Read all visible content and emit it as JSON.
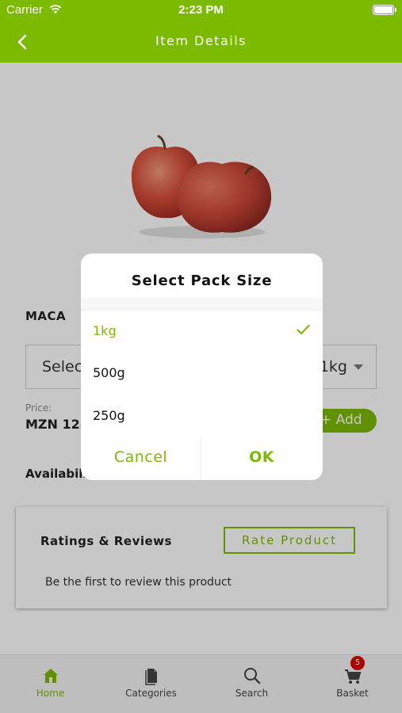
{
  "status_bar": {
    "carrier": "Carrier",
    "time": "2:23 PM"
  },
  "header": {
    "title": "Item Details"
  },
  "product": {
    "name": "MACA",
    "pack_select": {
      "placeholder": "Selec",
      "value": "1kg"
    },
    "price_label": "Price:",
    "price_value": "MZN 128",
    "add_label": "+ Add",
    "availability_label": "Availabili"
  },
  "reviews": {
    "heading": "Ratings & Reviews",
    "rate_button": "Rate Product",
    "empty_text": "Be the first to review this product"
  },
  "tab_bar": {
    "items": [
      {
        "label": "Home",
        "icon": "home-icon",
        "active": true
      },
      {
        "label": "Categories",
        "icon": "document-icon",
        "active": false
      },
      {
        "label": "Search",
        "icon": "search-icon",
        "active": false
      },
      {
        "label": "Basket",
        "icon": "cart-icon",
        "active": false,
        "badge": "5"
      }
    ]
  },
  "dialog": {
    "title": "Select Pack Size",
    "options": [
      {
        "label": "1kg",
        "selected": true
      },
      {
        "label": "500g",
        "selected": false
      },
      {
        "label": "250g",
        "selected": false
      }
    ],
    "cancel_label": "Cancel",
    "ok_label": "OK"
  },
  "colors": {
    "accent": "#7cba00",
    "badge": "#dd0000"
  }
}
